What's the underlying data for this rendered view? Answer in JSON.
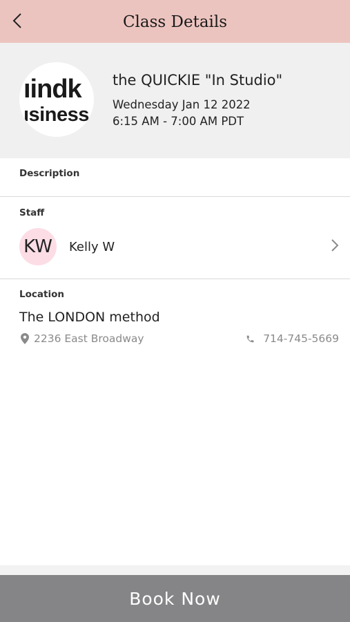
{
  "header": {
    "title": "Class Details"
  },
  "class_info": {
    "logo_line1": "ıindk",
    "logo_line2": "ısiness",
    "name": "the QUICKIE \"In Studio\"",
    "date": "Wednesday Jan 12 2022",
    "time": "6:15 AM - 7:00 AM PDT"
  },
  "description": {
    "label": "Description"
  },
  "staff": {
    "label": "Staff",
    "initials": "KW",
    "name": "Kelly W"
  },
  "location": {
    "label": "Location",
    "name": "The LONDON method",
    "address": "2236 East Broadway",
    "phone": "714-745-5669"
  },
  "actions": {
    "book_label": "Book Now"
  },
  "colors": {
    "header_bg": "#ecc4bf",
    "summary_bg": "#f0f0f0",
    "avatar_bg": "#fcdde6",
    "book_button_bg": "#858587"
  },
  "icons": {
    "back": "chevron-left-icon",
    "staff_chevron": "chevron-right-icon",
    "address": "map-pin-icon",
    "phone": "phone-icon"
  }
}
